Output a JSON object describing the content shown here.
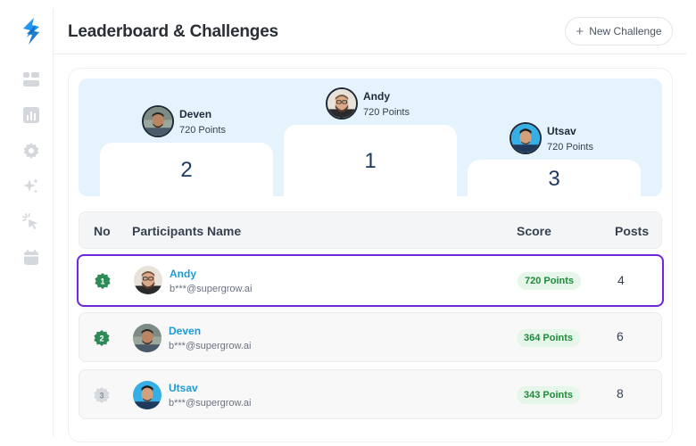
{
  "header": {
    "title": "Leaderboard & Challenges",
    "new_button_label": "New Challenge",
    "new_button_icon": "plus-icon"
  },
  "sidebar": {
    "items": [
      "dashboard-icon",
      "analytics-icon",
      "settings-icon",
      "sparkles-icon",
      "cursor-click-icon",
      "calendar-icon"
    ]
  },
  "podium": [
    {
      "rank": "2",
      "name": "Deven",
      "points": "720 Points"
    },
    {
      "rank": "1",
      "name": "Andy",
      "points": "720 Points"
    },
    {
      "rank": "3",
      "name": "Utsav",
      "points": "720 Points"
    }
  ],
  "table": {
    "headers": {
      "no": "No",
      "name": "Participants Name",
      "score": "Score",
      "posts": "Posts"
    },
    "rows": [
      {
        "rank": "1",
        "name": "Andy",
        "email": "b***@supergrow.ai",
        "score": "720 Points",
        "posts": "4"
      },
      {
        "rank": "2",
        "name": "Deven",
        "email": "b***@supergrow.ai",
        "score": "364 Points",
        "posts": "6"
      },
      {
        "rank": "3",
        "name": "Utsav",
        "email": "b***@supergrow.ai",
        "score": "343 Points",
        "posts": "8"
      }
    ]
  },
  "colors": {
    "accent": "#6d28d9",
    "podium_bg": "#e5f3fd",
    "name_link": "#1b9bd8",
    "score_bg": "#e6f6ea",
    "score_text": "#1f8a3a",
    "badge_green": "#2e8b57",
    "badge_gray": "#cbcfd4"
  }
}
